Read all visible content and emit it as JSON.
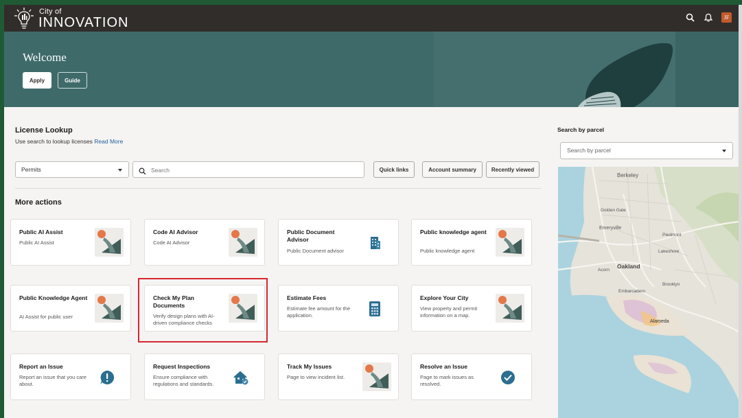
{
  "header": {
    "logo_small": "City of",
    "logo_big": "INNOVATION",
    "avatar_initials": "JF"
  },
  "banner": {
    "welcome": "Welcome",
    "apply_label": "Apply",
    "guide_label": "Guide"
  },
  "license_lookup": {
    "title": "License Lookup",
    "subtitle": "Use search to lookup licenses",
    "read_more": "Read More",
    "category_value": "Permits",
    "search_placeholder": "Search",
    "quick_links": "Quick links",
    "account_summary": "Account summary",
    "recently_viewed": "Recently viewed"
  },
  "more_actions": {
    "title": "More actions",
    "cards": [
      {
        "title": "Public AI Assist",
        "desc": "Public AI Assist",
        "icon": "image-placeholder-icon"
      },
      {
        "title": "Code AI Advisor",
        "desc": "Code AI Advisor",
        "icon": "image-placeholder-icon"
      },
      {
        "title": "Public Document Advisor",
        "desc": "Public Document advisor",
        "icon": "building-icon"
      },
      {
        "title": "Public knowledge agent",
        "desc": "Public knowledge agent",
        "icon": "image-placeholder-icon"
      },
      {
        "title": "Public Knowledge Agent",
        "desc": "AI Assist for public user",
        "icon": "image-placeholder-icon"
      },
      {
        "title": "Check My Plan Documents",
        "desc": "Verify design plans with AI-driven compliance checks",
        "icon": "image-placeholder-icon"
      },
      {
        "title": "Estimate Fees",
        "desc": "Estimate fee amount for the application.",
        "icon": "calculator-icon"
      },
      {
        "title": "Explore Your City",
        "desc": "View property and permit information on a map.",
        "icon": "image-placeholder-icon"
      },
      {
        "title": "Report an Issue",
        "desc": "Report an issue that you care about.",
        "icon": "alert-icon"
      },
      {
        "title": "Request Inspections",
        "desc": "Ensure compliance with regulations and standards.",
        "icon": "house-check-icon"
      },
      {
        "title": "Track My Issues",
        "desc": "Page to view incident list.",
        "icon": "image-placeholder-icon"
      },
      {
        "title": "Resolve an Issue",
        "desc": "Page to mark issues as resolved.",
        "icon": "check-circle-icon"
      }
    ]
  },
  "parcel": {
    "label": "Search by parcel",
    "placeholder": "Search by parcel",
    "map_labels": [
      "Berkeley",
      "Golden Gate",
      "Emeryville",
      "Piedmont",
      "Oakland",
      "Lakeshore",
      "Alameda",
      "Acorn",
      "Brooklyn",
      "Embarcadero"
    ]
  },
  "colors": {
    "topbar": "#312d2a",
    "banner": "#3f6a6a",
    "accent_link": "#1f5f9e",
    "highlight": "#d6262f",
    "icon_teal": "#2c6e8f"
  }
}
